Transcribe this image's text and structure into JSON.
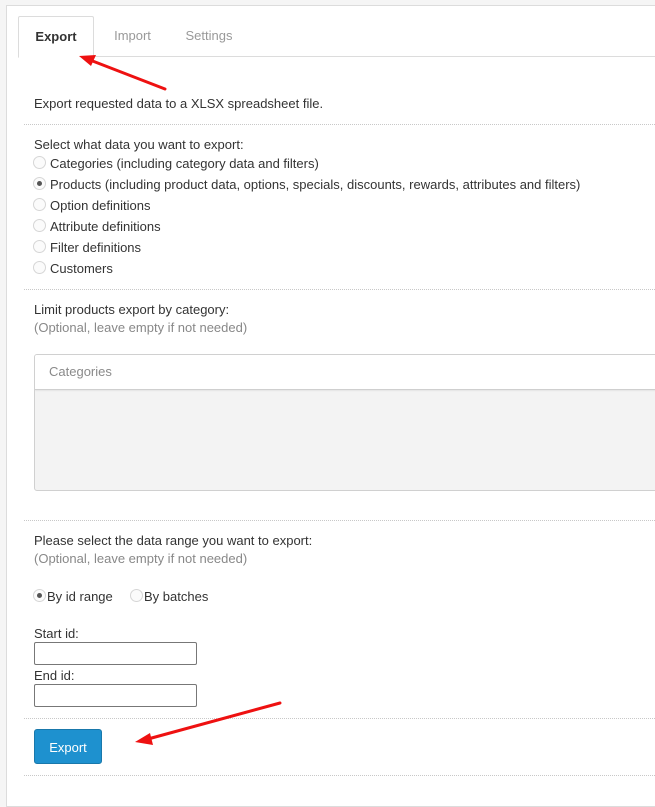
{
  "tabs": [
    {
      "label": "Export",
      "active": true
    },
    {
      "label": "Import",
      "active": false
    },
    {
      "label": "Settings",
      "active": false
    }
  ],
  "export": {
    "intro": "Export requested data to a XLSX spreadsheet file.",
    "data_type": {
      "label": "Select what data you want to export:",
      "selected": "Products",
      "options": [
        {
          "label": "Categories (including category data and filters)",
          "checked": false
        },
        {
          "label": "Products (including product data, options, specials, discounts, rewards, attributes and filters)",
          "checked": true
        },
        {
          "label": "Option definitions",
          "checked": false
        },
        {
          "label": "Attribute definitions",
          "checked": false
        },
        {
          "label": "Filter definitions",
          "checked": false
        },
        {
          "label": "Customers",
          "checked": false
        }
      ]
    },
    "category_limit": {
      "label": "Limit products export by category:",
      "hint": "(Optional, leave empty if not needed)",
      "placeholder": "Categories"
    },
    "range": {
      "label": "Please select the data range you want to export:",
      "hint": "(Optional, leave empty if not needed)",
      "options": [
        {
          "label": "By id range",
          "checked": true
        },
        {
          "label": "By batches",
          "checked": false
        }
      ],
      "start_label": "Start id:",
      "start_value": "",
      "end_label": "End id:",
      "end_value": ""
    },
    "submit_label": "Export"
  },
  "colors": {
    "primary_button": "#1e91cf",
    "annotation_arrow": "#ee1111"
  }
}
